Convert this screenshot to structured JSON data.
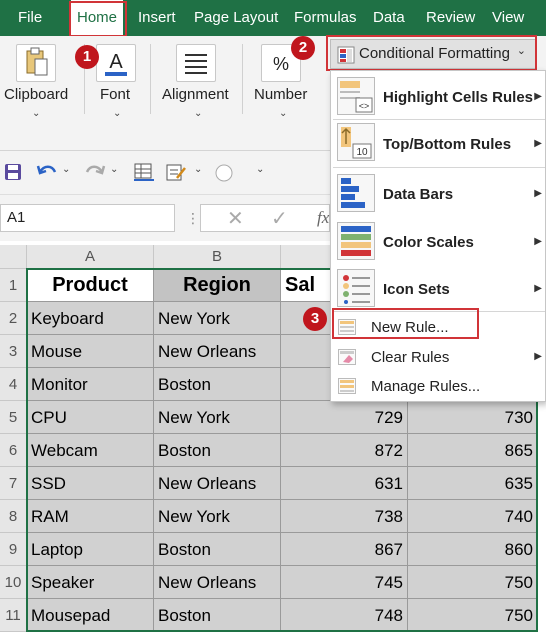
{
  "tabs": [
    "File",
    "Home",
    "Insert",
    "Page Layout",
    "Formulas",
    "Data",
    "Review",
    "View"
  ],
  "ribbon": {
    "clipboard": "Clipboard",
    "font": "Font",
    "alignment": "Alignment",
    "number": "Number",
    "number_icon": "%",
    "font_icon": "A",
    "conditional_formatting": "Conditional Formatting"
  },
  "name_box": "A1",
  "formula_fx": "fx",
  "columns": [
    "A",
    "B"
  ],
  "rows": [
    "1",
    "2",
    "3",
    "4",
    "5",
    "6",
    "7",
    "8",
    "9",
    "10",
    "11"
  ],
  "table": {
    "headers": [
      "Product",
      "Region",
      "Sal"
    ],
    "data": [
      [
        "Keyboard",
        "New York",
        "",
        ""
      ],
      [
        "Mouse",
        "New Orleans",
        "",
        ""
      ],
      [
        "Monitor",
        "Boston",
        "",
        ""
      ],
      [
        "CPU",
        "New York",
        "729",
        "730"
      ],
      [
        "Webcam",
        "Boston",
        "872",
        "865"
      ],
      [
        "SSD",
        "New Orleans",
        "631",
        "635"
      ],
      [
        "RAM",
        "New York",
        "738",
        "740"
      ],
      [
        "Laptop",
        "Boston",
        "867",
        "860"
      ],
      [
        "Speaker",
        "New Orleans",
        "745",
        "750"
      ],
      [
        "Mousepad",
        "Boston",
        "748",
        "750"
      ]
    ]
  },
  "menu": {
    "highlight": "Highlight Cells Rules",
    "topbottom": "Top/Bottom Rules",
    "databars": "Data Bars",
    "colorscales": "Color Scales",
    "iconsets": "Icon Sets",
    "newrule": "New Rule...",
    "clearrules": "Clear Rules",
    "managerules": "Manage Rules...",
    "topbottom_icon_num": "10"
  },
  "badges": [
    "1",
    "2",
    "3"
  ],
  "colors": {
    "excel_green": "#1f7145",
    "highlight_red": "#d13438",
    "badge_red": "#c0161d"
  }
}
